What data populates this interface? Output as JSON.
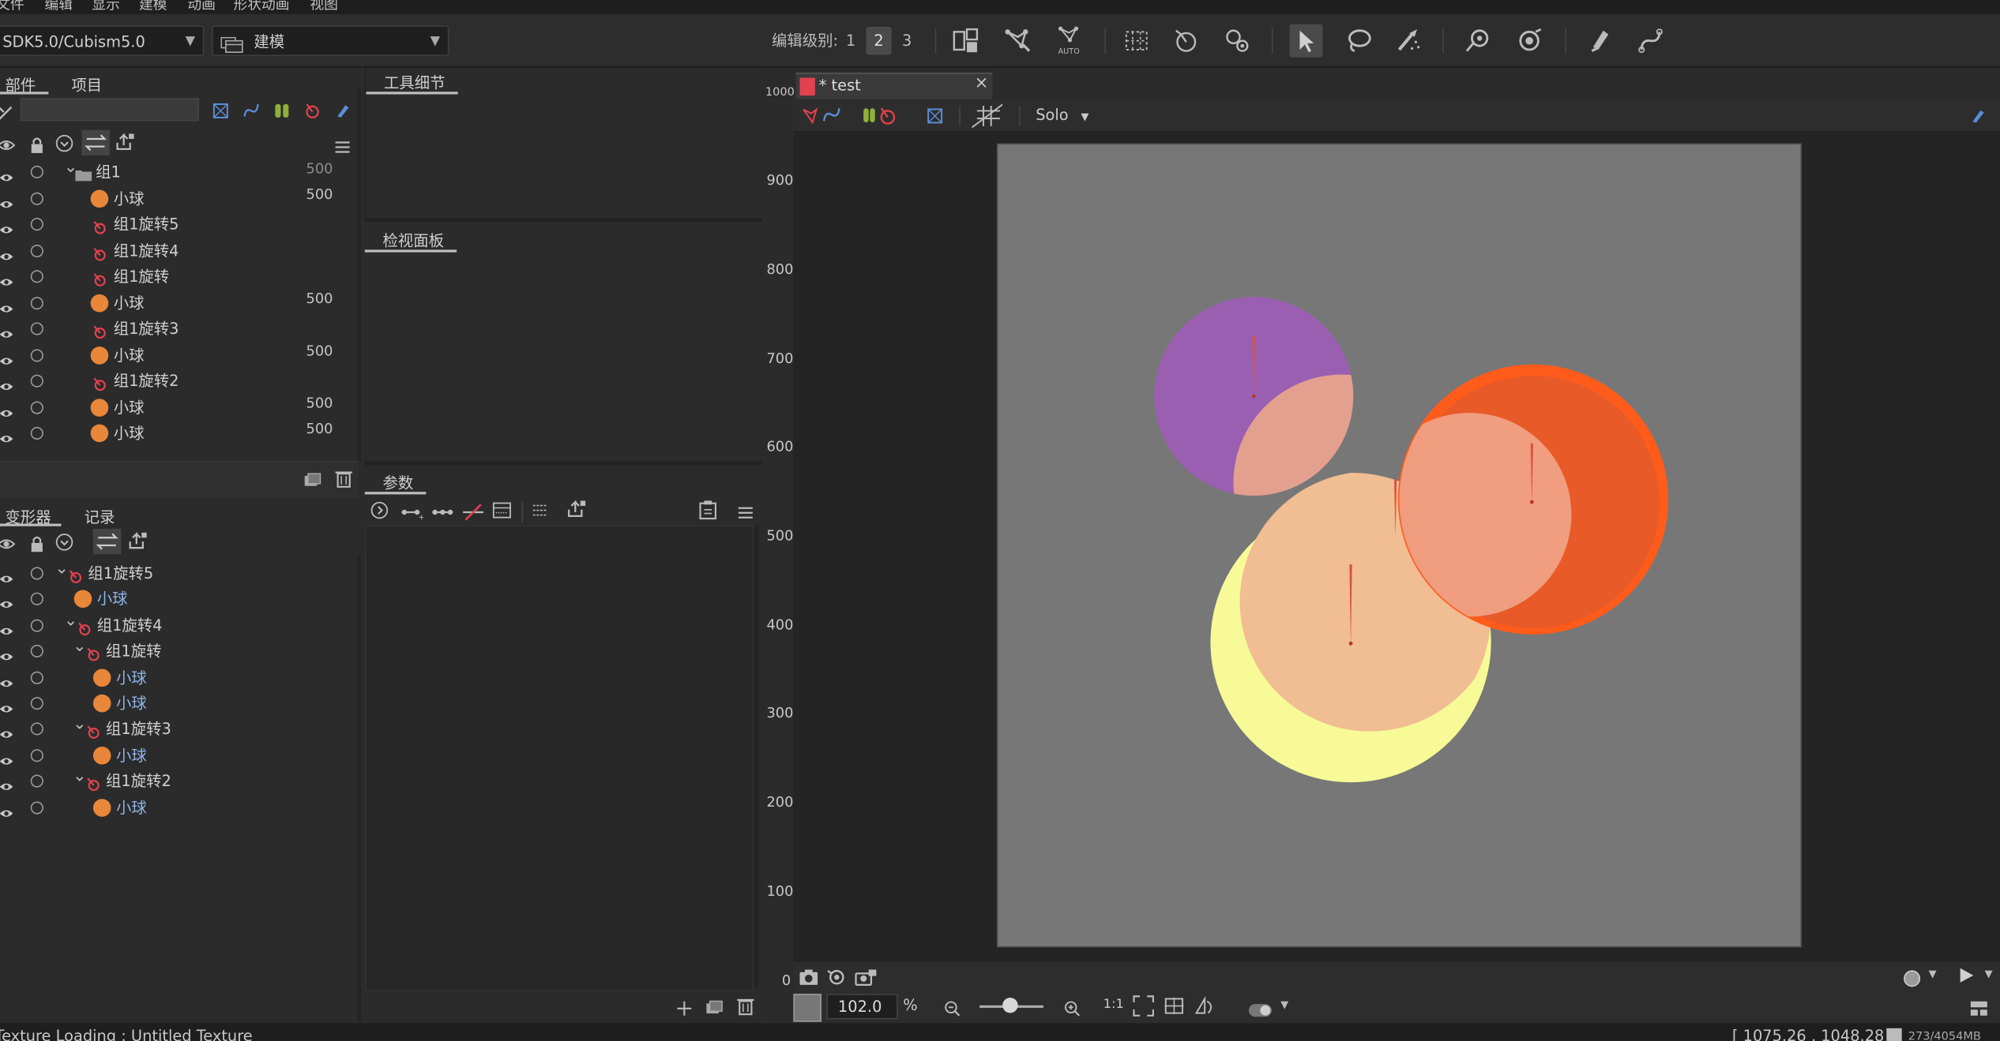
{
  "menu": [
    "文件",
    "编辑",
    "显示",
    "建模",
    "动画",
    "形状动画",
    "视图"
  ],
  "toolbar": {
    "sdk_select": "SDK5.0/Cubism5.0",
    "mode_select": "建模",
    "edit_level_label": "编辑级别:",
    "levels": [
      "1",
      "2",
      "3"
    ],
    "active_level": "2",
    "auto_label": "AUTO"
  },
  "parts_panel": {
    "tabs": [
      "部件",
      "项目"
    ],
    "search_placeholder": "",
    "rows": [
      {
        "name": "组1",
        "type": "folder",
        "depth": 0,
        "expanded": true,
        "value": "500",
        "dim": true
      },
      {
        "name": "小球",
        "type": "ball",
        "depth": 1,
        "value": "500"
      },
      {
        "name": "组1旋转5",
        "type": "rotation",
        "depth": 1,
        "value": ""
      },
      {
        "name": "组1旋转4",
        "type": "rotation",
        "depth": 1,
        "value": ""
      },
      {
        "name": "组1旋转",
        "type": "rotation",
        "depth": 1,
        "value": ""
      },
      {
        "name": "小球",
        "type": "ball",
        "depth": 1,
        "value": "500"
      },
      {
        "name": "组1旋转3",
        "type": "rotation",
        "depth": 1,
        "value": ""
      },
      {
        "name": "小球",
        "type": "ball",
        "depth": 1,
        "value": "500"
      },
      {
        "name": "组1旋转2",
        "type": "rotation",
        "depth": 1,
        "value": ""
      },
      {
        "name": "小球",
        "type": "ball",
        "depth": 1,
        "value": "500"
      },
      {
        "name": "小球",
        "type": "ball",
        "depth": 1,
        "value": "500"
      }
    ]
  },
  "deformer_panel": {
    "tabs": [
      "变形器",
      "记录"
    ],
    "rows": [
      {
        "name": "组1旋转5",
        "type": "rotation",
        "indent": 48,
        "expanded": true
      },
      {
        "name": "小球",
        "type": "ball",
        "indent": 58
      },
      {
        "name": "组1旋转4",
        "type": "rotation",
        "indent": 55,
        "expanded": true
      },
      {
        "name": "组1旋转",
        "type": "rotation",
        "indent": 62,
        "expanded": true
      },
      {
        "name": "小球",
        "type": "ball",
        "indent": 73
      },
      {
        "name": "小球",
        "type": "ball",
        "indent": 73
      },
      {
        "name": "组1旋转3",
        "type": "rotation",
        "indent": 62,
        "expanded": true
      },
      {
        "name": "小球",
        "type": "ball",
        "indent": 73
      },
      {
        "name": "组1旋转2",
        "type": "rotation",
        "indent": 62,
        "expanded": true
      },
      {
        "name": "小球",
        "type": "ball",
        "indent": 73
      }
    ]
  },
  "tool_details": {
    "title": "工具细节"
  },
  "inspector": {
    "title": "检视面板"
  },
  "parameters": {
    "title": "参数"
  },
  "canvas": {
    "tab_title": "* test",
    "solo_label": "Solo",
    "ruler": [
      "1000",
      "900",
      "800",
      "700",
      "600",
      "500",
      "400",
      "300",
      "200",
      "100",
      "0"
    ],
    "zoom_value": "102.0",
    "zoom_unit": "%",
    "ratio_label": "1:1",
    "colors": {
      "purple": "#9b5fb2",
      "peach": "#f1bd92",
      "yellow": "#f7fa97",
      "orange": "#f35a26",
      "salmon": "#ef9f83",
      "artboard": "#777777"
    }
  },
  "status": {
    "left": "Texture Loading : Untitled Texture",
    "coords": "[ 1075.26 , 1048.28 ]",
    "memory": "273/4054MB"
  }
}
